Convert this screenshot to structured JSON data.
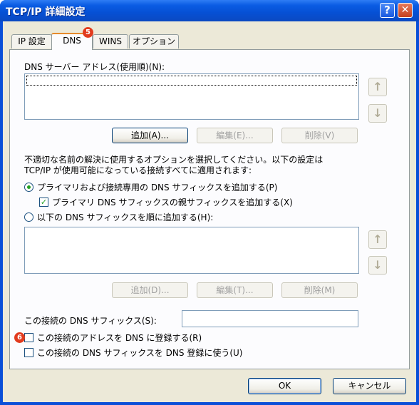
{
  "window": {
    "title": "TCP/IP 詳細設定",
    "help_glyph": "?",
    "close_glyph": "✕"
  },
  "tabs": [
    {
      "label": "IP 設定",
      "active": false
    },
    {
      "label": "DNS",
      "active": true
    },
    {
      "label": "WINS",
      "active": false
    },
    {
      "label": "オプション",
      "active": false
    }
  ],
  "badges": {
    "dns_tab": "5",
    "register": "6"
  },
  "dns_servers": {
    "label": "DNS サーバー アドレス(使用順)(N):",
    "items": [],
    "up_icon": "arrow-up-icon",
    "down_icon": "arrow-down-icon"
  },
  "server_buttons": {
    "add": "追加(A)...",
    "edit": "編集(E)...",
    "delete": "削除(V)"
  },
  "description": {
    "line1": "不適切な名前の解決に使用するオプションを選択してください。以下の設定は",
    "line2": "TCP/IP が使用可能になっている接続すべてに適用されます:"
  },
  "options": {
    "primary_suffix": {
      "label": "プライマリおよび接続専用の DNS サフィックスを追加する(P)",
      "selected": true
    },
    "parent_suffix": {
      "label": "プライマリ DNS サフィックスの親サフィックスを追加する(X)",
      "checked": true
    },
    "ordered_suffix": {
      "label": "以下の DNS サフィックスを順に追加する(H):",
      "selected": false
    }
  },
  "suffix_list": {
    "items": []
  },
  "suffix_buttons": {
    "add": "追加(D)...",
    "edit": "編集(T)...",
    "delete": "削除(M)"
  },
  "connection_suffix": {
    "label": "この接続の DNS サフィックス(S):",
    "value": ""
  },
  "register": {
    "register_address": {
      "label": "この接続のアドレスを DNS に登録する(R)",
      "checked": false
    },
    "use_suffix": {
      "label": "この接続の DNS サフィックスを DNS 登録に使う(U)",
      "checked": false
    }
  },
  "footer": {
    "ok": "OK",
    "cancel": "キャンセル"
  },
  "colors": {
    "titlebar": "#0a5ce3",
    "face": "#ece9d8",
    "panel": "#fcfcfe",
    "accent_tab": "#e68b2c",
    "badge": "#e23b1e",
    "check": "#21a121"
  }
}
